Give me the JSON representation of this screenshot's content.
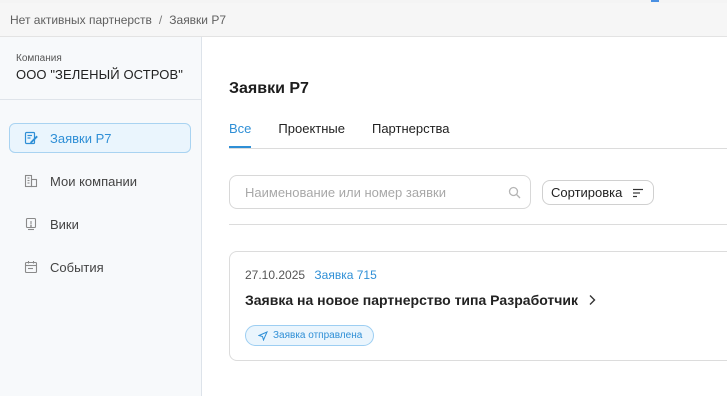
{
  "breadcrumb": {
    "items": [
      "Нет активных партнерств",
      "Заявки Р7"
    ],
    "separator": "/"
  },
  "sidebar": {
    "company_label": "Компания",
    "company_name": "ООО \"ЗЕЛЕНЫЙ ОСТРОВ\"",
    "items": [
      {
        "label": "Заявки Р7",
        "icon": "edit-document-icon",
        "active": true
      },
      {
        "label": "Мои компании",
        "icon": "buildings-icon",
        "active": false
      },
      {
        "label": "Вики",
        "icon": "info-document-icon",
        "active": false
      },
      {
        "label": "События",
        "icon": "calendar-icon",
        "active": false
      }
    ]
  },
  "main": {
    "title": "Заявки Р7",
    "tabs": [
      {
        "label": "Все",
        "active": true
      },
      {
        "label": "Проектные",
        "active": false
      },
      {
        "label": "Партнерства",
        "active": false
      }
    ],
    "search": {
      "placeholder": "Наименование или номер заявки",
      "value": ""
    },
    "sort_label": "Сортировка",
    "requests": [
      {
        "date": "27.10.2025",
        "number_label": "Заявка 715",
        "title": "Заявка на новое партнерство типа Разработчик",
        "status": "Заявка отправлена"
      }
    ]
  },
  "colors": {
    "accent": "#2f8fd6",
    "active_bg": "#eaf5fd",
    "sidebar_bg": "#f7f9fb"
  }
}
